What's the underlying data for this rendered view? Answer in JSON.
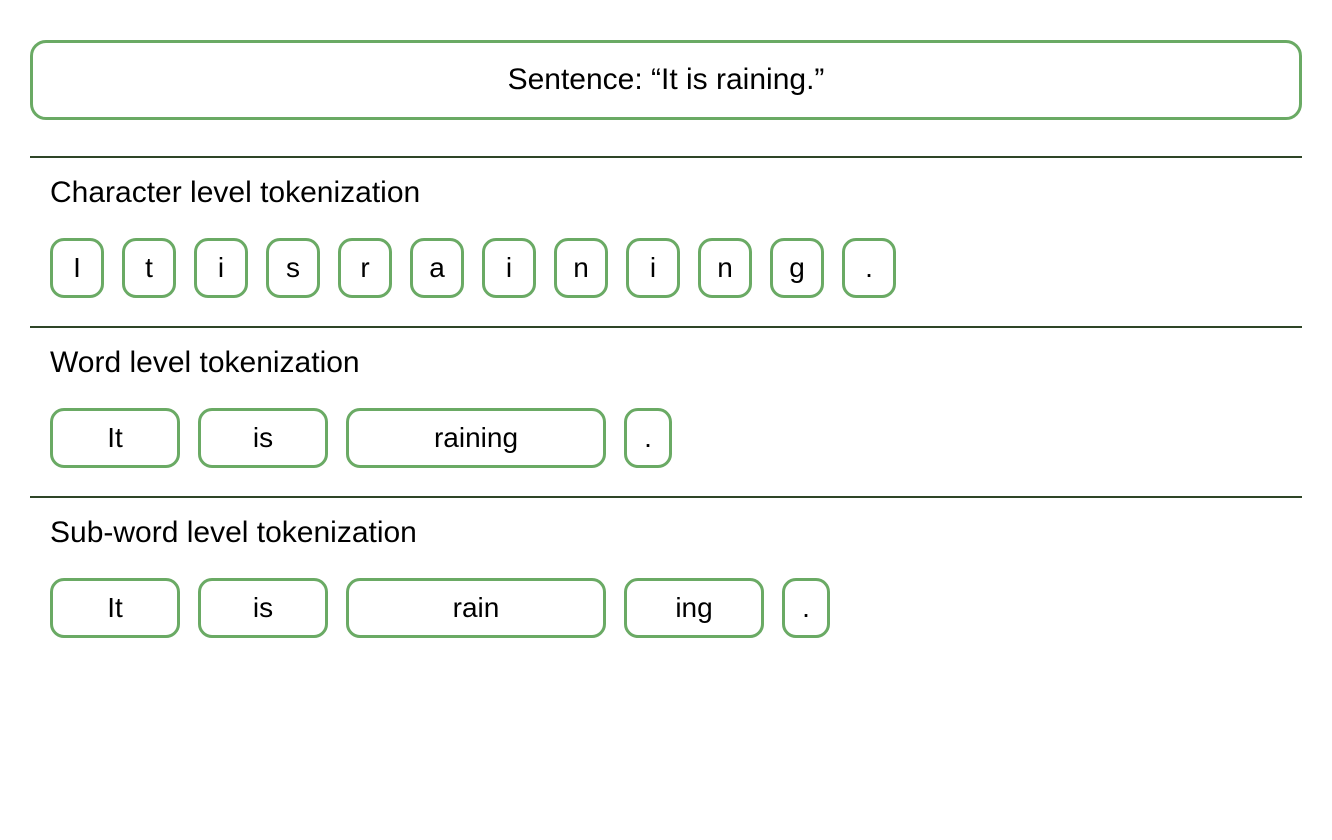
{
  "sentence": {
    "label": "Sentence: “It is raining.”"
  },
  "sections": {
    "char": {
      "title": "Character level tokenization",
      "tokens": [
        "I",
        "t",
        "i",
        "s",
        "r",
        "a",
        "i",
        "n",
        "i",
        "n",
        "g",
        "."
      ]
    },
    "word": {
      "title": "Word level tokenization",
      "tokens": [
        "It",
        "is",
        "raining",
        "."
      ]
    },
    "subword": {
      "title": "Sub-word level tokenization",
      "tokens": [
        "It",
        "is",
        "rain",
        "ing",
        "."
      ]
    }
  }
}
